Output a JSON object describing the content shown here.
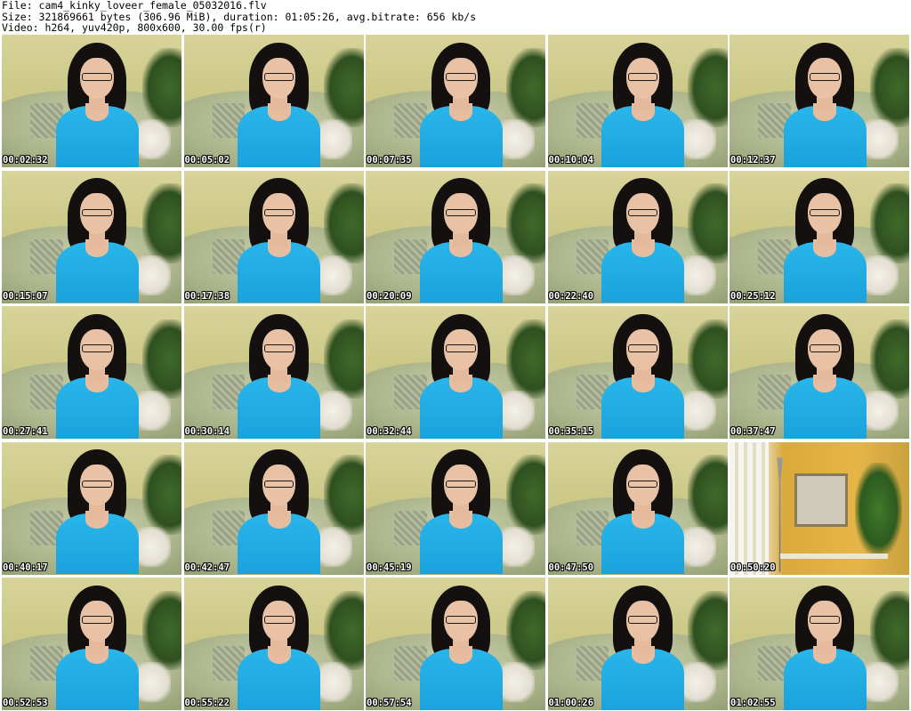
{
  "header": {
    "file_line": "File: cam4_kinky_loveer_female_05032016.flv",
    "size_line": "Size: 321869661 bytes (306.96 MiB), duration: 01:05:26, avg.bitrate: 656 kb/s",
    "video_line": "Video: h264, yuv420p, 800x600, 30.00 fps(r)"
  },
  "thumbnails": [
    {
      "timestamp": "00:02:32"
    },
    {
      "timestamp": "00:05:02"
    },
    {
      "timestamp": "00:07:35"
    },
    {
      "timestamp": "00:10:04"
    },
    {
      "timestamp": "00:12:37"
    },
    {
      "timestamp": "00:15:07"
    },
    {
      "timestamp": "00:17:38"
    },
    {
      "timestamp": "00:20:09"
    },
    {
      "timestamp": "00:22:40"
    },
    {
      "timestamp": "00:25:12"
    },
    {
      "timestamp": "00:27:41"
    },
    {
      "timestamp": "00:30:14"
    },
    {
      "timestamp": "00:32:44"
    },
    {
      "timestamp": "00:35:15"
    },
    {
      "timestamp": "00:37:47"
    },
    {
      "timestamp": "00:40:17"
    },
    {
      "timestamp": "00:42:47"
    },
    {
      "timestamp": "00:45:19"
    },
    {
      "timestamp": "00:47:50"
    },
    {
      "timestamp": "00:50:20"
    },
    {
      "timestamp": "00:52:53"
    },
    {
      "timestamp": "00:55:22"
    },
    {
      "timestamp": "00:57:54"
    },
    {
      "timestamp": "01:00:26"
    },
    {
      "timestamp": "01:02:55"
    }
  ]
}
